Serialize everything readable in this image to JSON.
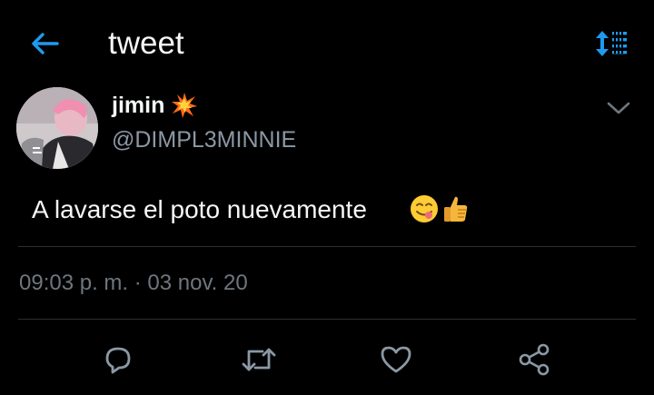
{
  "header": {
    "title": "tweet",
    "back_icon": "arrow-left-icon",
    "sort_icon": "sort-updown-icon",
    "accent_color": "#1d9bf0"
  },
  "author": {
    "display_name": "jimin",
    "name_emoji": "collision-emoji",
    "handle": "@DIMPL3MINNIE",
    "avatar": "avatar-image",
    "more_icon": "chevron-down-icon"
  },
  "tweet": {
    "text": "A lavarse el poto nuevamente",
    "emojis": [
      "face-savoring-food-emoji",
      "thumbs-up-emoji"
    ],
    "timestamp": "09:03 p. m. · 03 nov. 20"
  },
  "actions": [
    {
      "name": "reply",
      "icon": "reply-icon"
    },
    {
      "name": "retweet",
      "icon": "retweet-icon"
    },
    {
      "name": "like",
      "icon": "heart-icon"
    },
    {
      "name": "share",
      "icon": "share-icon"
    }
  ],
  "colors": {
    "background": "#000000",
    "text_primary": "#f4f6f7",
    "text_secondary": "#8b98a5",
    "divider": "#2b2f33",
    "icon_gray": "#8b98a5"
  }
}
